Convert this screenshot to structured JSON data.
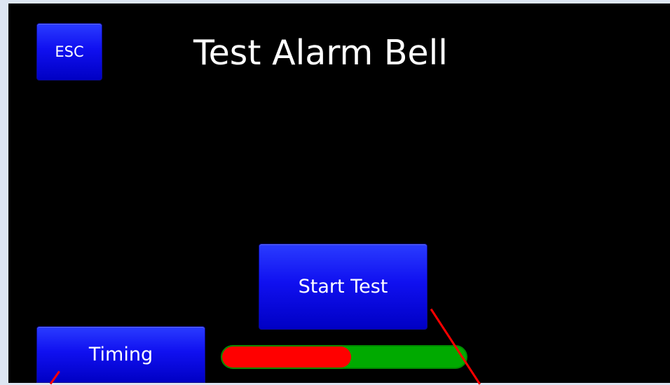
{
  "screen": {
    "title": "Test Alarm Bell",
    "esc_label": "ESC",
    "start_label": "Start Test",
    "timing_label": "Timing"
  },
  "progress": {
    "value_fraction": 0.53,
    "fill_color": "#ff0000",
    "track_color": "#00aa00"
  },
  "colors": {
    "button": "#0000ee",
    "screen_background": "#000000",
    "page_background": "#dde6f3",
    "annotation_line": "#ff0000"
  }
}
